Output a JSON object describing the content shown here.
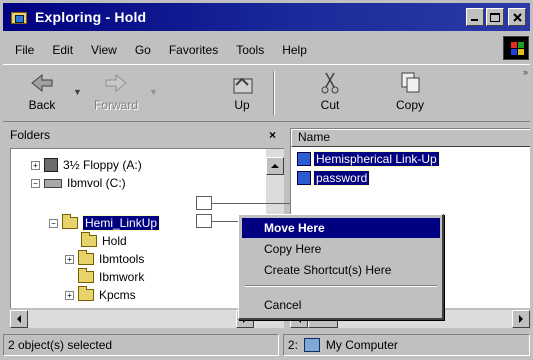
{
  "window": {
    "title": "Exploring - Hold"
  },
  "menu": [
    "File",
    "Edit",
    "View",
    "Go",
    "Favorites",
    "Tools",
    "Help"
  ],
  "toolbar": {
    "back": "Back",
    "forward": "Forward",
    "up": "Up",
    "cut": "Cut",
    "copy": "Copy"
  },
  "folders": {
    "header": "Folders",
    "close_glyph": "×",
    "items": [
      {
        "label": "3½ Floppy (A:)"
      },
      {
        "label": "Ibmvol (C:)"
      },
      {
        "label": "Hemi_LinkUp"
      },
      {
        "label": "Hold"
      },
      {
        "label": "Ibmtools"
      },
      {
        "label": "Ibmwork"
      },
      {
        "label": "Kpcms"
      }
    ]
  },
  "name_pane": {
    "header": "Name",
    "files": [
      {
        "label": "Hemispherical Link-Up"
      },
      {
        "label": "password"
      }
    ]
  },
  "context_menu": {
    "items": [
      "Move Here",
      "Copy Here",
      "Create Shortcut(s) Here",
      "Cancel"
    ]
  },
  "status": {
    "selected": "2 object(s) selected",
    "count": "2:",
    "location": "My Computer"
  },
  "colors": {
    "titlebar": "#000080",
    "selection": "#000080",
    "chrome": "#c0c0c0"
  }
}
